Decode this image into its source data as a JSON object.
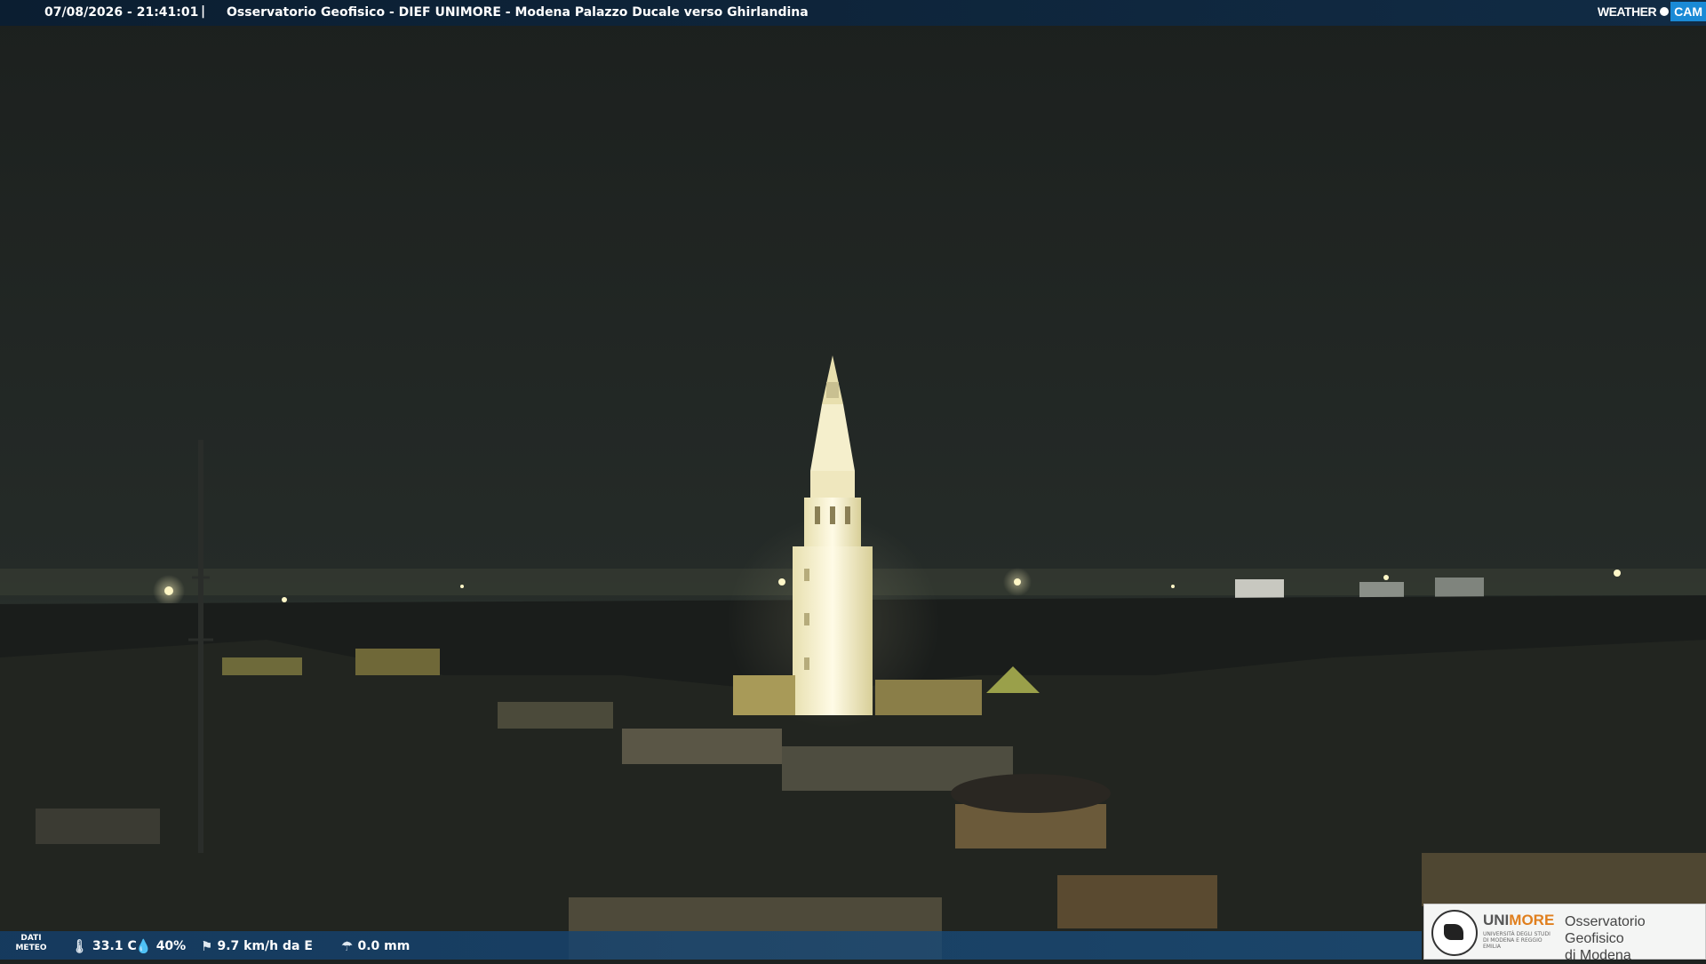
{
  "header": {
    "datetime": "07/08/2026 - 21:41:01",
    "separator": "|",
    "title": "Osservatorio Geofisico - DIEF UNIMORE - Modena Palazzo Ducale verso Ghirlandina"
  },
  "brand": {
    "weather_label": "WEATHER",
    "cam_label": "CAM",
    "accent_color": "#1a8ad6"
  },
  "meteo": {
    "label_line1": "DATI",
    "label_line2": "METEO",
    "temperature": "33.1 C",
    "humidity": "40%",
    "wind": "9.7 km/h da E",
    "rain": "0.0 mm",
    "icons": [
      "thermometer-icon",
      "humidity-drop-icon",
      "wind-vane-icon",
      "rain-gauge-icon"
    ]
  },
  "logo": {
    "uni_part1": "UNI",
    "uni_part2": "MORE",
    "uni_sub": "UNIVERSITÀ DEGLI STUDI DI MODENA E REGGIO EMILIA",
    "observatory_line1": "Osservatorio Geofisico",
    "observatory_line2": "di Modena",
    "orange_color": "#e07f1e"
  }
}
